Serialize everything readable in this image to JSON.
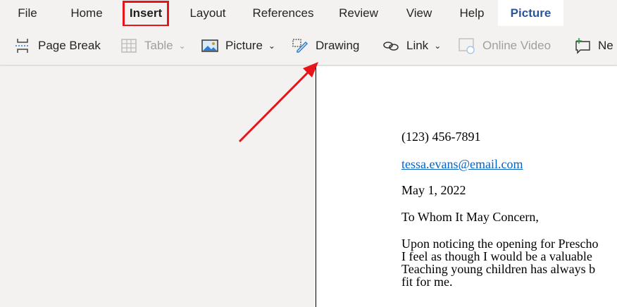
{
  "tabs": [
    "File",
    "Home",
    "Insert",
    "Layout",
    "References",
    "Review",
    "View",
    "Help",
    "Picture"
  ],
  "toolbar": {
    "page_break": "Page Break",
    "table": "Table",
    "picture": "Picture",
    "drawing": "Drawing",
    "link": "Link",
    "online_video": "Online Video",
    "new_comment": "Ne"
  },
  "document": {
    "phone": "(123) 456-7891",
    "email": "tessa.evans@email.com",
    "date": "May 1, 2022",
    "salutation": "To Whom It May Concern,",
    "paragraph": [
      "Upon noticing the opening for Prescho",
      "I feel as though I would be a valuable",
      "Teaching young children has always b",
      "fit for me."
    ]
  },
  "colors": {
    "highlight": "#e8141c",
    "accent": "#2b579a"
  }
}
